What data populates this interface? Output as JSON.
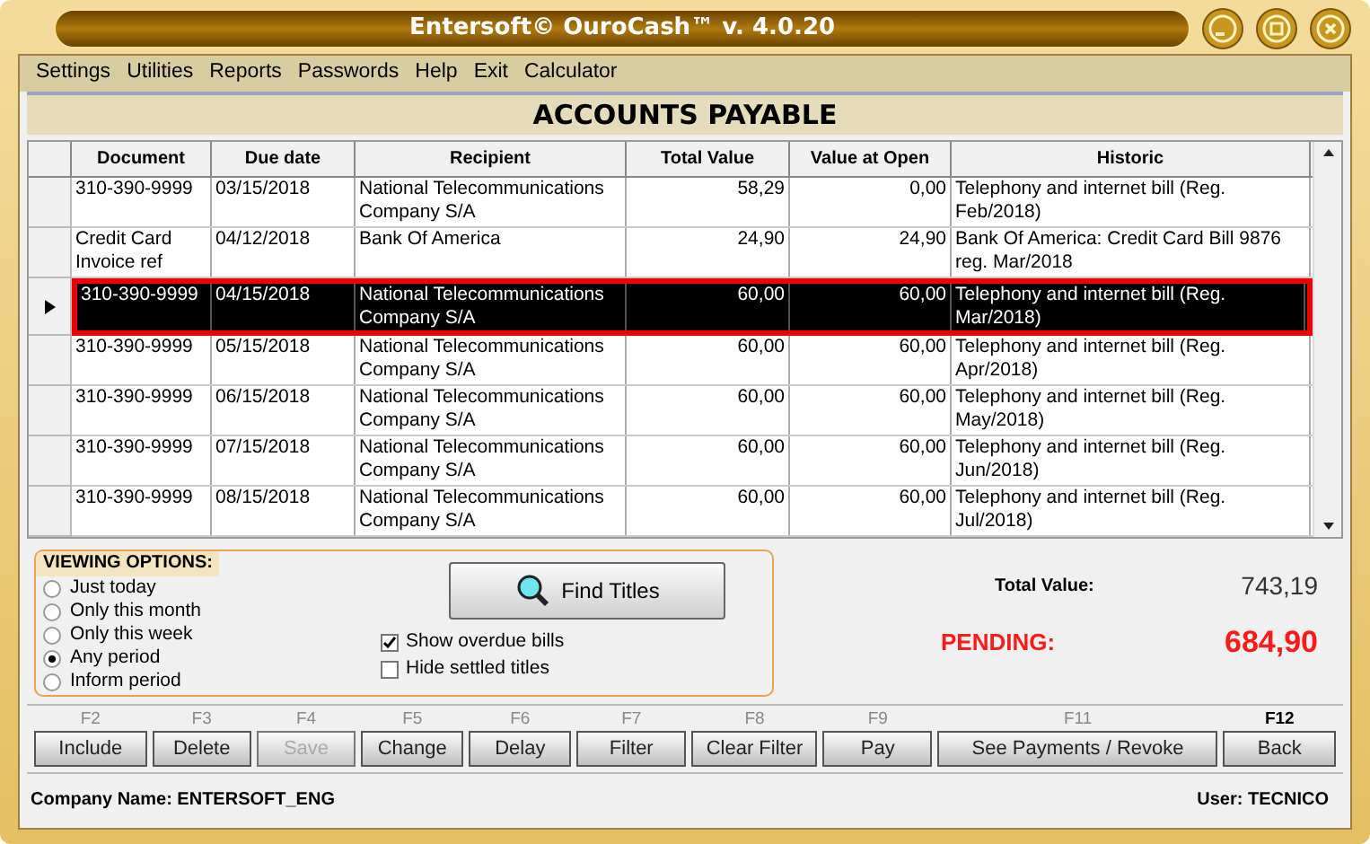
{
  "window": {
    "title": "Entersoft© OuroCash™ v. 4.0.20"
  },
  "menu": [
    "Settings",
    "Utilities",
    "Reports",
    "Passwords",
    "Help",
    "Exit",
    "Calculator"
  ],
  "heading": "ACCOUNTS PAYABLE",
  "table": {
    "columns": [
      "Document",
      "Due date",
      "Recipient",
      "Total Value",
      "Value at Open",
      "Historic"
    ],
    "rows": [
      {
        "selected": false,
        "cells": [
          "310-390-9999",
          "03/15/2018",
          "National Telecommunications Company S/A",
          "58,29",
          "0,00",
          "Telephony and internet bill (Reg. Feb/2018)"
        ]
      },
      {
        "selected": false,
        "cells": [
          "Credit Card Invoice ref",
          "04/12/2018",
          "Bank Of America",
          "24,90",
          "24,90",
          "Bank Of America: Credit Card Bill 9876 reg. Mar/2018"
        ]
      },
      {
        "selected": true,
        "cells": [
          "310-390-9999",
          "04/15/2018",
          "National Telecommunications Company S/A",
          "60,00",
          "60,00",
          "Telephony and internet bill (Reg. Mar/2018)"
        ]
      },
      {
        "selected": false,
        "cells": [
          "310-390-9999",
          "05/15/2018",
          "National Telecommunications Company S/A",
          "60,00",
          "60,00",
          "Telephony and internet bill (Reg. Apr/2018)"
        ]
      },
      {
        "selected": false,
        "cells": [
          "310-390-9999",
          "06/15/2018",
          "National Telecommunications Company S/A",
          "60,00",
          "60,00",
          "Telephony and internet bill (Reg. May/2018)"
        ]
      },
      {
        "selected": false,
        "cells": [
          "310-390-9999",
          "07/15/2018",
          "National Telecommunications Company S/A",
          "60,00",
          "60,00",
          "Telephony and internet bill (Reg. Jun/2018)"
        ]
      },
      {
        "selected": false,
        "cells": [
          "310-390-9999",
          "08/15/2018",
          "National Telecommunications Company S/A",
          "60,00",
          "60,00",
          "Telephony and internet bill (Reg. Jul/2018)"
        ]
      }
    ]
  },
  "viewing_options": {
    "title": "VIEWING OPTIONS:",
    "radios": [
      {
        "label": "Just today",
        "selected": false
      },
      {
        "label": "Only this month",
        "selected": false
      },
      {
        "label": "Only this week",
        "selected": false
      },
      {
        "label": "Any period",
        "selected": true
      },
      {
        "label": "Inform period",
        "selected": false
      }
    ],
    "find_button": "Find Titles",
    "checkboxes": [
      {
        "label": "Show overdue bills",
        "checked": true
      },
      {
        "label": "Hide settled titles",
        "checked": false
      }
    ]
  },
  "totals": {
    "total_label": "Total Value:",
    "total_value": "743,19",
    "pending_label": "PENDING:",
    "pending_value": "684,90"
  },
  "buttons": [
    {
      "key": "F2",
      "label": "Include",
      "disabled": false,
      "key_bold": false
    },
    {
      "key": "F3",
      "label": "Delete",
      "disabled": false,
      "key_bold": false
    },
    {
      "key": "F4",
      "label": "Save",
      "disabled": true,
      "key_bold": false
    },
    {
      "key": "F5",
      "label": "Change",
      "disabled": false,
      "key_bold": false
    },
    {
      "key": "F6",
      "label": "Delay",
      "disabled": false,
      "key_bold": false
    },
    {
      "key": "F7",
      "label": "Filter",
      "disabled": false,
      "key_bold": false
    },
    {
      "key": "F8",
      "label": "Clear Filter",
      "disabled": false,
      "key_bold": false
    },
    {
      "key": "F9",
      "label": "Pay",
      "disabled": false,
      "key_bold": false
    },
    {
      "key": "F11",
      "label": "See Payments / Revoke",
      "disabled": false,
      "key_bold": false
    },
    {
      "key": "F12",
      "label": "Back",
      "disabled": false,
      "key_bold": true
    }
  ],
  "status_bar": {
    "company": "Company Name: ENTERSOFT_ENG",
    "user": "User: TECNICO"
  }
}
